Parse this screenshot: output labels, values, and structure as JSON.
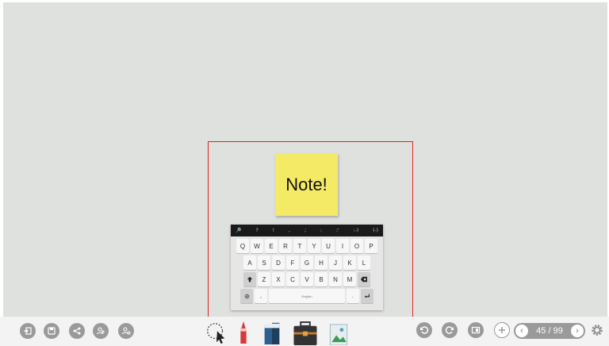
{
  "sticky_note": {
    "text": "Note!"
  },
  "keyboard": {
    "top_symbols": [
      "🔎",
      "?",
      "!",
      ",",
      ";",
      ":",
      ":'",
      ":-)",
      "(-)"
    ],
    "row1": [
      "Q",
      "W",
      "E",
      "R",
      "T",
      "Y",
      "U",
      "I",
      "O",
      "P"
    ],
    "row2": [
      "A",
      "S",
      "D",
      "F",
      "G",
      "H",
      "J",
      "K",
      "L"
    ],
    "row3": [
      "Z",
      "X",
      "C",
      "V",
      "B",
      "N",
      "M"
    ],
    "space_label": "English"
  },
  "pager": {
    "text": "45 / 99",
    "prev_icon": "chevron-left-icon",
    "next_icon": "chevron-right-icon"
  },
  "colors": {
    "selection": "#e02020",
    "sticky": "#f5ea66",
    "canvas": "#dfe1de",
    "button": "#9a9a9a"
  }
}
